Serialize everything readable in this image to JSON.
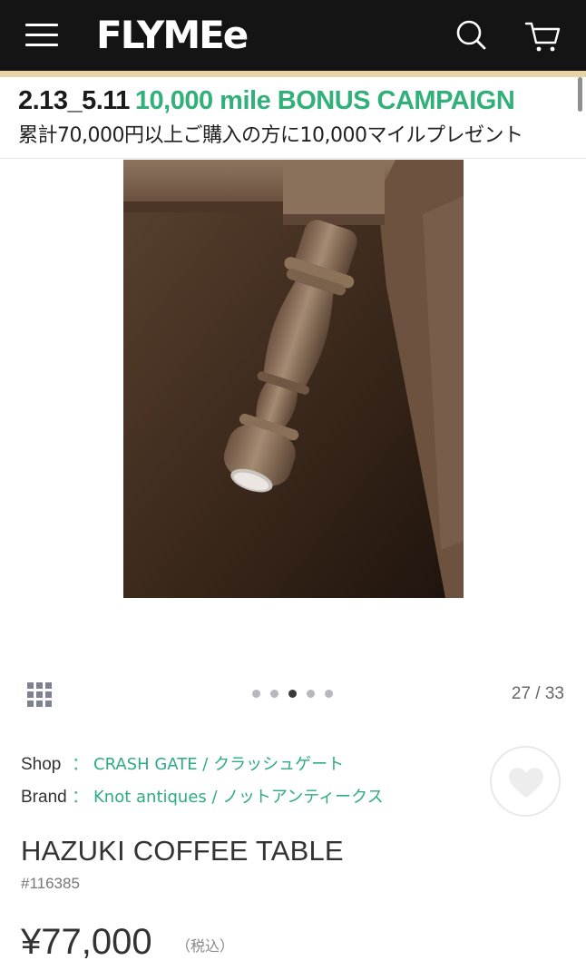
{
  "header": {
    "logo": "FLYMEe",
    "menu_icon": "hamburger-menu-icon",
    "search_icon": "search-icon",
    "cart_icon": "cart-icon",
    "background": "#141414"
  },
  "banner": {
    "dates": "2.13_5.11",
    "campaign": "10,000 mile BONUS CAMPAIGN",
    "subtitle": "累計70,000円以上ご購入の方に10,000マイルプレゼント",
    "accent_color": "#32b07a"
  },
  "gallery": {
    "current": 27,
    "total": 33,
    "counter": "27 / 33",
    "dot_count": 5,
    "active_dot": 3,
    "grid_icon": "grid-view-icon"
  },
  "product": {
    "shop_label": "Shop",
    "shop_value": "CRASH GATE / クラッシュゲート",
    "brand_label": "Brand",
    "brand_value": "Knot antiques / ノットアンティークス",
    "separator": "：",
    "title": "HAZUKI COFFEE TABLE",
    "code": "#116385",
    "price": "¥77,000",
    "tax_note": "（税込）",
    "favorite_icon": "heart-icon",
    "link_color": "#2eaa86"
  }
}
